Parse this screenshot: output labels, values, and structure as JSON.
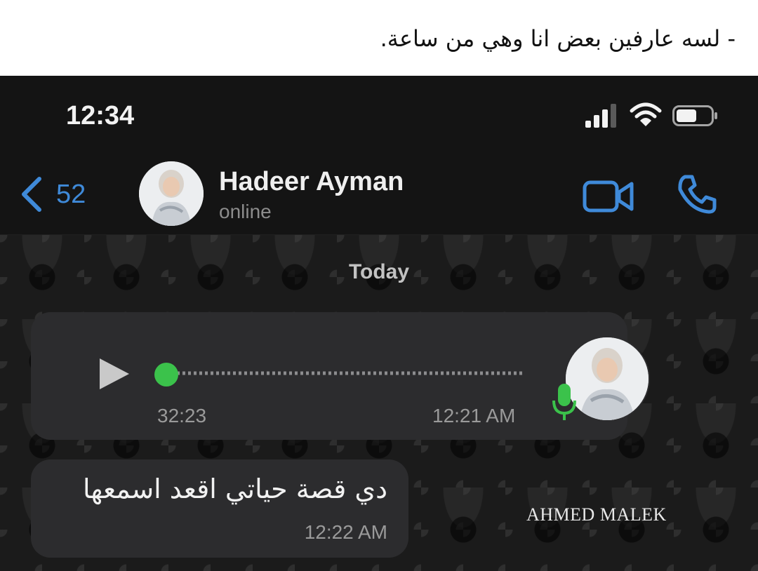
{
  "caption": {
    "text": "- لسه عارفين بعض انا وهي من ساعة."
  },
  "status_bar": {
    "time": "12:34",
    "icons": [
      "signal-icon",
      "wifi-icon",
      "battery-icon"
    ]
  },
  "header": {
    "back_count": "52",
    "contact_name": "Hadeer Ayman",
    "contact_status": "online",
    "actions": [
      "video-call-icon",
      "phone-icon"
    ]
  },
  "chat": {
    "date_label": "Today",
    "voice_message": {
      "duration": "32:23",
      "time": "12:21 AM",
      "progress": 0
    },
    "text_message": {
      "text": "دي قصة حياتي اقعد اسمعها",
      "time": "12:22 AM"
    },
    "watermark": "AHMED MALEK"
  },
  "colors": {
    "accent_blue": "#3f8ad9",
    "accent_green": "#3bc24b",
    "bubble": "#2c2c2e",
    "header_bg": "#141414"
  }
}
